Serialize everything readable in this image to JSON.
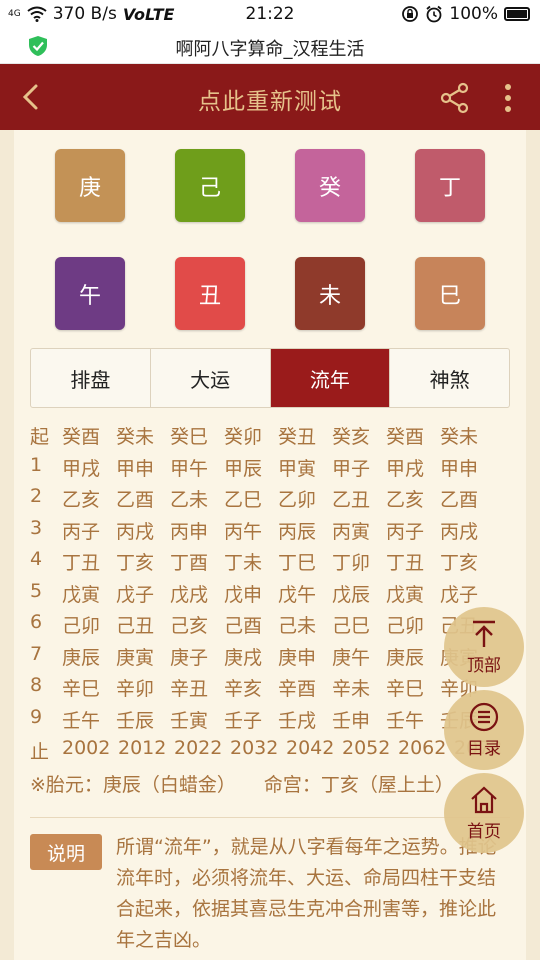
{
  "status_bar": {
    "signal": "4G",
    "net_speed": "370 B/s",
    "volte": "VoLTE",
    "time": "21:22",
    "battery": "100%"
  },
  "browser": {
    "title": "啊阿八字算命_汉程生活"
  },
  "header": {
    "title": "点此重新测试"
  },
  "tiles_top": [
    {
      "char": "庚",
      "color": "#c39256"
    },
    {
      "char": "己",
      "color": "#6f9e1b"
    },
    {
      "char": "癸",
      "color": "#c4649b"
    },
    {
      "char": "丁",
      "color": "#c05b6b"
    }
  ],
  "tiles_bottom": [
    {
      "char": "午",
      "color": "#6e3b84"
    },
    {
      "char": "丑",
      "color": "#e14b49"
    },
    {
      "char": "未",
      "color": "#8f3a2b"
    },
    {
      "char": "巳",
      "color": "#c7845a"
    }
  ],
  "tabs": [
    "排盘",
    "大运",
    "流年",
    "神煞"
  ],
  "active_tab": "流年",
  "liunian": {
    "rows": [
      {
        "label": "起",
        "cells": [
          "癸酉",
          "癸未",
          "癸巳",
          "癸卯",
          "癸丑",
          "癸亥",
          "癸酉",
          "癸未"
        ]
      },
      {
        "label": "1",
        "cells": [
          "甲戌",
          "甲申",
          "甲午",
          "甲辰",
          "甲寅",
          "甲子",
          "甲戌",
          "甲申"
        ]
      },
      {
        "label": "2",
        "cells": [
          "乙亥",
          "乙酉",
          "乙未",
          "乙巳",
          "乙卯",
          "乙丑",
          "乙亥",
          "乙酉"
        ]
      },
      {
        "label": "3",
        "cells": [
          "丙子",
          "丙戌",
          "丙申",
          "丙午",
          "丙辰",
          "丙寅",
          "丙子",
          "丙戌"
        ]
      },
      {
        "label": "4",
        "cells": [
          "丁丑",
          "丁亥",
          "丁酉",
          "丁未",
          "丁巳",
          "丁卯",
          "丁丑",
          "丁亥"
        ]
      },
      {
        "label": "5",
        "cells": [
          "戊寅",
          "戊子",
          "戊戌",
          "戊申",
          "戊午",
          "戊辰",
          "戊寅",
          "戊子"
        ]
      },
      {
        "label": "6",
        "cells": [
          "己卯",
          "己丑",
          "己亥",
          "己酉",
          "己未",
          "己巳",
          "己卯",
          "己丑"
        ]
      },
      {
        "label": "7",
        "cells": [
          "庚辰",
          "庚寅",
          "庚子",
          "庚戌",
          "庚申",
          "庚午",
          "庚辰",
          "庚寅"
        ]
      },
      {
        "label": "8",
        "cells": [
          "辛巳",
          "辛卯",
          "辛丑",
          "辛亥",
          "辛酉",
          "辛未",
          "辛巳",
          "辛卯"
        ]
      },
      {
        "label": "9",
        "cells": [
          "壬午",
          "壬辰",
          "壬寅",
          "壬子",
          "壬戌",
          "壬申",
          "壬午",
          "壬辰"
        ]
      }
    ],
    "end_row": {
      "label": "止",
      "cells": [
        "2002",
        "2012",
        "2022",
        "2032",
        "2042",
        "2052",
        "2062",
        "2072"
      ]
    }
  },
  "notes": {
    "taiyuan": "※胎元：庚辰（白蜡金）",
    "minggong": "命宫：丁亥（屋上土）"
  },
  "explain": {
    "badge": "说明",
    "text": "所谓“流年”，就是从八字看每年之运势。推论流年时，必须将流年、大运、命局四柱干支结合起来，依据其喜忌生克冲合刑害等，推论此年之吉凶。"
  },
  "fabs": {
    "top": "顶部",
    "catalog": "目录",
    "home": "首页"
  }
}
